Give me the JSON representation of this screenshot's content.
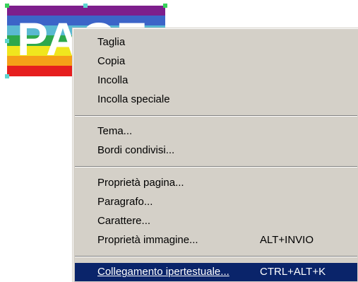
{
  "image": {
    "word": "PACE",
    "stripe_colors": [
      "#7d1e8c",
      "#3c64c8",
      "#5ab9d2",
      "#2ea84c",
      "#f0e61e",
      "#f5a018",
      "#e61e1e"
    ]
  },
  "context_menu": {
    "items": [
      {
        "label": "Taglia",
        "shortcut": ""
      },
      {
        "label": "Copia",
        "shortcut": ""
      },
      {
        "label": "Incolla",
        "shortcut": ""
      },
      {
        "label": "Incolla speciale",
        "shortcut": ""
      },
      {
        "label": "Tema...",
        "shortcut": ""
      },
      {
        "label": "Bordi condivisi...",
        "shortcut": ""
      },
      {
        "label": "Proprietà pagina...",
        "shortcut": ""
      },
      {
        "label": "Paragrafo...",
        "shortcut": ""
      },
      {
        "label": "Carattere...",
        "shortcut": ""
      },
      {
        "label": "Proprietà immagine...",
        "shortcut": "ALT+INVIO"
      },
      {
        "label": "Collegamento ipertestuale...",
        "shortcut": "CTRL+ALT+K"
      }
    ],
    "highlighted_item": "Collegamento ipertestuale...",
    "colors": {
      "background": "#d4d0c8",
      "highlight": "#0a246a",
      "highlight_text": "#ffffff"
    }
  }
}
